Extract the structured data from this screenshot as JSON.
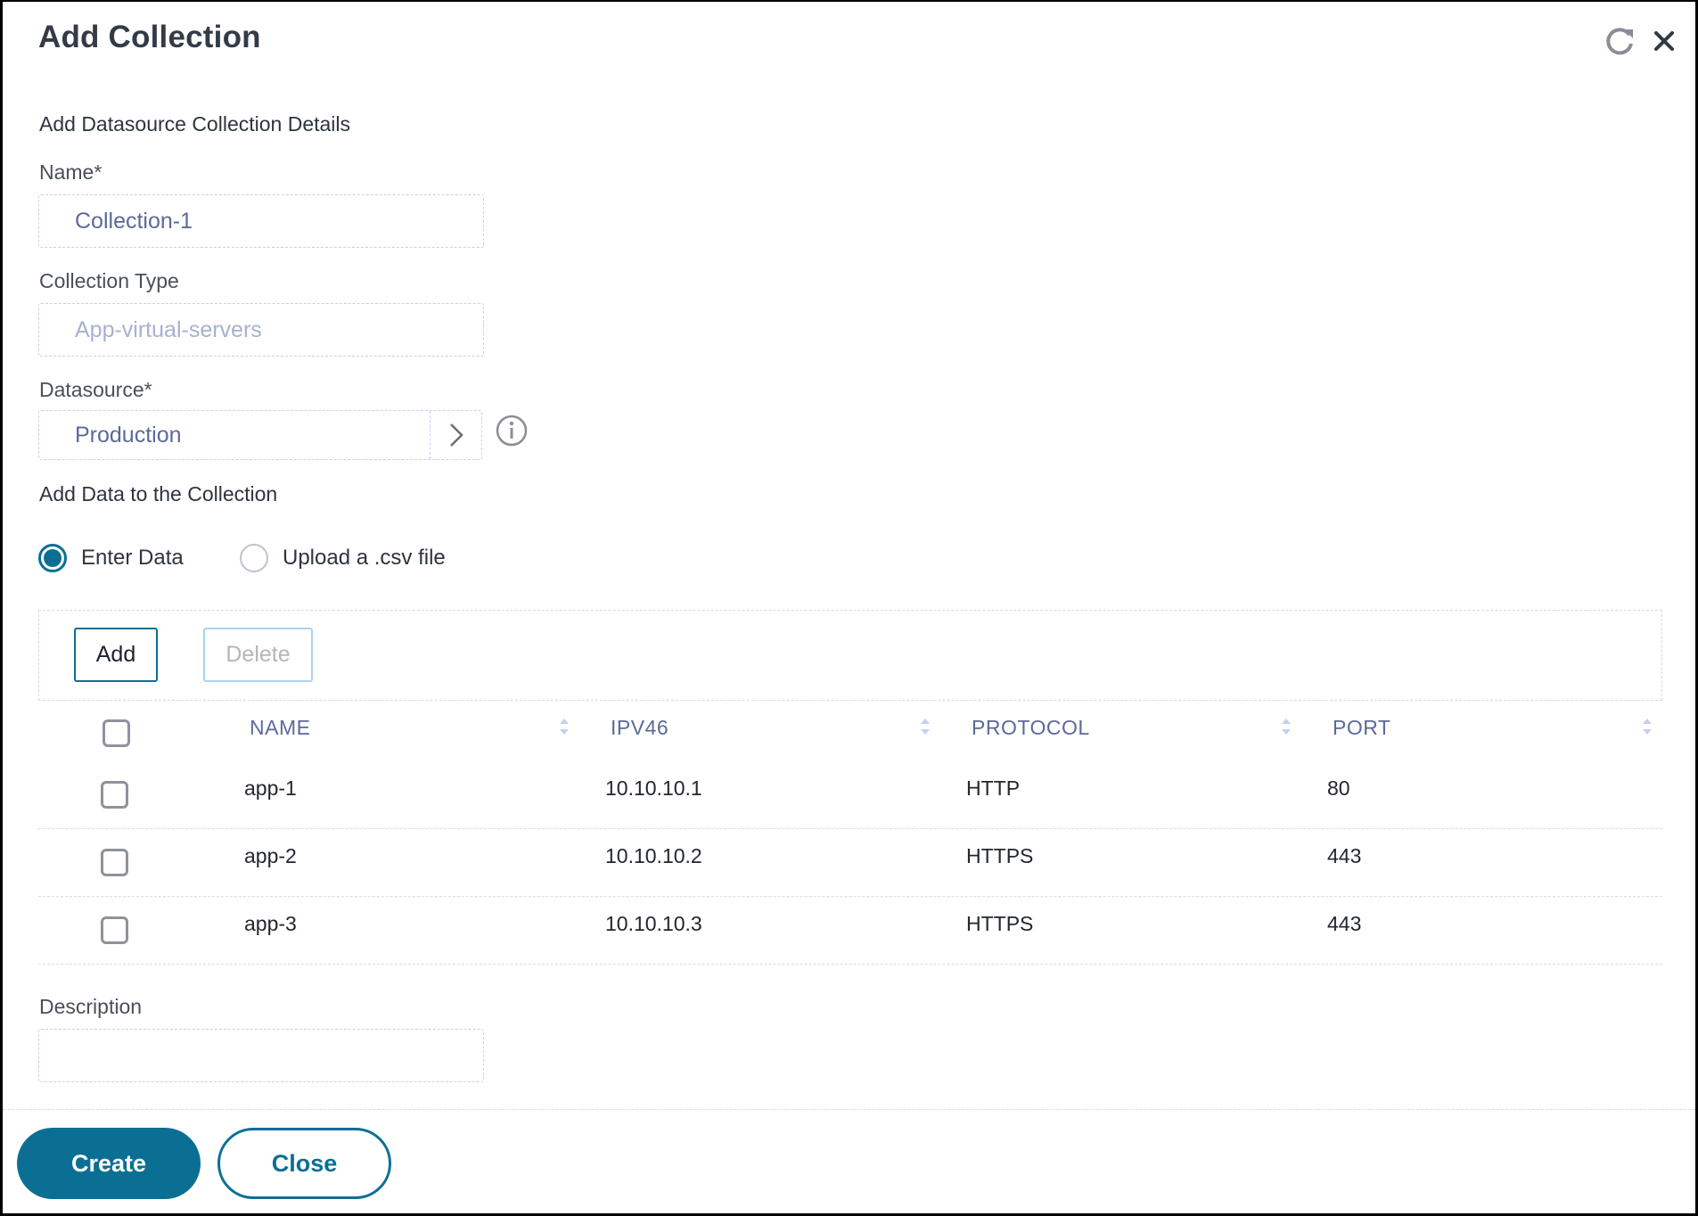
{
  "dialog": {
    "title": "Add Collection",
    "icons": {
      "refresh": "refresh-icon",
      "close": "close-icon"
    }
  },
  "form": {
    "section_title": "Add Datasource Collection Details",
    "name": {
      "label": "Name*",
      "value": "Collection-1"
    },
    "collection_type": {
      "label": "Collection Type",
      "value": "App-virtual-servers"
    },
    "datasource": {
      "label": "Datasource*",
      "value": "Production",
      "chevron_icon": "chevron-right-icon",
      "info_icon": "info-icon"
    },
    "data_section_title": "Add Data to the Collection",
    "data_mode": {
      "options": [
        {
          "label": "Enter Data",
          "checked": true
        },
        {
          "label": "Upload a .csv file",
          "checked": false
        }
      ]
    },
    "description": {
      "label": "Description",
      "value": ""
    }
  },
  "table": {
    "toolbar": {
      "add_label": "Add",
      "delete_label": "Delete"
    },
    "columns": [
      "NAME",
      "IPV46",
      "PROTOCOL",
      "PORT"
    ],
    "rows": [
      {
        "name": "app-1",
        "ip": "10.10.10.1",
        "protocol": "HTTP",
        "port": "80"
      },
      {
        "name": "app-2",
        "ip": "10.10.10.2",
        "protocol": "HTTPS",
        "port": "443"
      },
      {
        "name": "app-3",
        "ip": "10.10.10.3",
        "protocol": "HTTPS",
        "port": "443"
      }
    ]
  },
  "footer": {
    "create_label": "Create",
    "close_label": "Close"
  },
  "colors": {
    "accent": "#0b6f94",
    "field_text": "#5b6a98",
    "disabled_text": "#a6b1d1",
    "border": "#c9cfee"
  }
}
